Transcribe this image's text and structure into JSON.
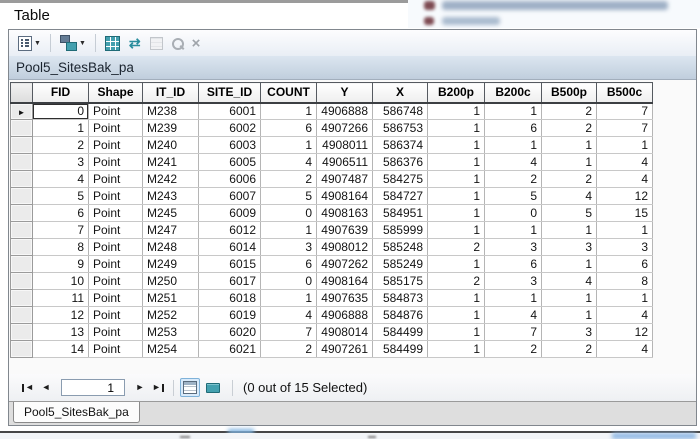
{
  "window": {
    "title": "Table"
  },
  "toolbar": {
    "icons": [
      {
        "name": "table-options",
        "enabled": true,
        "has_dropdown": true
      },
      {
        "name": "related-tables",
        "enabled": true,
        "has_dropdown": true
      },
      {
        "name": "select-related-records",
        "enabled": true
      },
      {
        "name": "switch-selection",
        "enabled": true
      },
      {
        "name": "clear-selection",
        "enabled": false
      },
      {
        "name": "zoom-to-selected",
        "enabled": false
      },
      {
        "name": "delete-selected",
        "enabled": false
      }
    ]
  },
  "layer_tab": "Pool5_SitesBak_pa",
  "table": {
    "columns": [
      "FID",
      "Shape",
      "IT_ID",
      "SITE_ID",
      "COUNT",
      "Y",
      "X",
      "B200p",
      "B200c",
      "B500p",
      "B500c"
    ],
    "rows": [
      [
        "0",
        "Point",
        "M238",
        "6001",
        "1",
        "4906888",
        "586748",
        "1",
        "1",
        "2",
        "7"
      ],
      [
        "1",
        "Point",
        "M239",
        "6002",
        "6",
        "4907266",
        "586753",
        "1",
        "6",
        "2",
        "7"
      ],
      [
        "2",
        "Point",
        "M240",
        "6003",
        "1",
        "4908011",
        "586374",
        "1",
        "1",
        "1",
        "1"
      ],
      [
        "3",
        "Point",
        "M241",
        "6005",
        "4",
        "4906511",
        "586376",
        "1",
        "4",
        "1",
        "4"
      ],
      [
        "4",
        "Point",
        "M242",
        "6006",
        "2",
        "4907487",
        "584275",
        "1",
        "2",
        "2",
        "4"
      ],
      [
        "5",
        "Point",
        "M243",
        "6007",
        "5",
        "4908164",
        "584727",
        "1",
        "5",
        "4",
        "12"
      ],
      [
        "6",
        "Point",
        "M245",
        "6009",
        "0",
        "4908163",
        "584951",
        "1",
        "0",
        "5",
        "15"
      ],
      [
        "7",
        "Point",
        "M247",
        "6012",
        "1",
        "4907639",
        "585999",
        "1",
        "1",
        "1",
        "1"
      ],
      [
        "8",
        "Point",
        "M248",
        "6014",
        "3",
        "4908012",
        "585248",
        "2",
        "3",
        "3",
        "3"
      ],
      [
        "9",
        "Point",
        "M249",
        "6015",
        "6",
        "4907262",
        "585249",
        "1",
        "6",
        "1",
        "6"
      ],
      [
        "10",
        "Point",
        "M250",
        "6017",
        "0",
        "4908164",
        "585175",
        "2",
        "3",
        "4",
        "8"
      ],
      [
        "11",
        "Point",
        "M251",
        "6018",
        "1",
        "4907635",
        "584873",
        "1",
        "1",
        "1",
        "1"
      ],
      [
        "12",
        "Point",
        "M252",
        "6019",
        "4",
        "4906888",
        "584876",
        "1",
        "4",
        "1",
        "4"
      ],
      [
        "13",
        "Point",
        "M253",
        "6020",
        "7",
        "4908014",
        "584499",
        "1",
        "7",
        "3",
        "12"
      ],
      [
        "14",
        "Point",
        "M254",
        "6021",
        "2",
        "4907261",
        "584499",
        "1",
        "2",
        "2",
        "4"
      ]
    ],
    "active_row": 0
  },
  "record_nav": {
    "current_record": "1",
    "status": "(0 out of 15 Selected)"
  },
  "bottom_tab": "Pool5_SitesBak_pa",
  "colors": {
    "teal_icon": "#43a0af",
    "layer_bar_top": "#dce6f0",
    "layer_bar_bottom": "#c0cedd",
    "view_active_border": "#7fb2d9"
  }
}
